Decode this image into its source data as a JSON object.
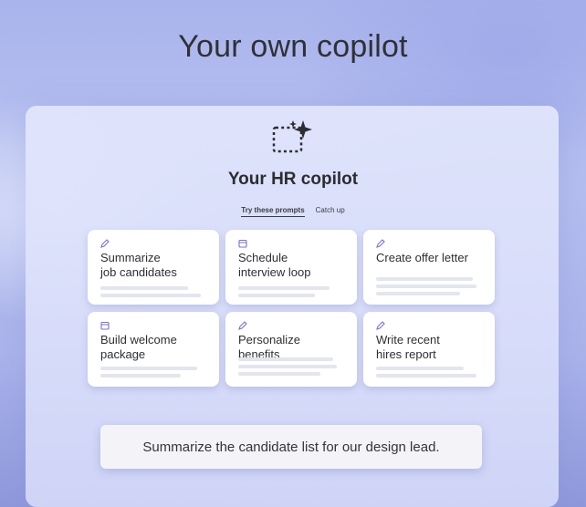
{
  "hero": {
    "title": "Your own copilot"
  },
  "panel": {
    "title": "Your HR copilot",
    "logo_icon": "sparkle-selection-icon",
    "tabs": [
      {
        "label": "Try these prompts",
        "active": true
      },
      {
        "label": "Catch up",
        "active": false
      }
    ]
  },
  "cards": [
    {
      "label": "Summarize\njob candidates",
      "icon": "pen-icon"
    },
    {
      "label": "Schedule\ninterview loop",
      "icon": "calendar-icon"
    },
    {
      "label": "Create offer letter",
      "icon": "pen-icon"
    },
    {
      "label": "Build welcome\npackage",
      "icon": "calendar-icon"
    },
    {
      "label": "Personalize benefits",
      "icon": "pen-icon"
    },
    {
      "label": "Write recent\nhires report",
      "icon": "pen-icon"
    }
  ],
  "prompt": {
    "text": "Summarize the candidate list for our design lead."
  },
  "colors": {
    "accent": "#7a6fd6",
    "background": "#b7c0f0"
  }
}
